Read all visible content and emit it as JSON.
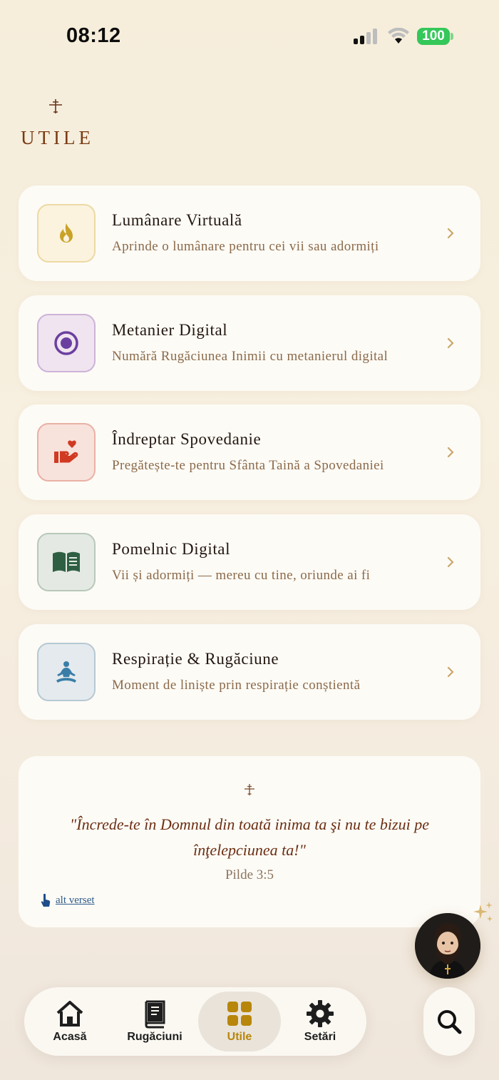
{
  "status_bar": {
    "time": "08:12",
    "battery": "100"
  },
  "header": {
    "title": "UTILE"
  },
  "cards": [
    {
      "title": "Lumânare Virtuală",
      "subtitle": "Aprinde o lumânare pentru cei vii sau adormiți",
      "icon": "flame-icon",
      "color": "#c9a227"
    },
    {
      "title": "Metanier Digital",
      "subtitle": "Numără Rugăciunea Inimii cu metanierul digital",
      "icon": "target-icon",
      "color": "#6b3fa0"
    },
    {
      "title": "Îndreptar Spovedanie",
      "subtitle": "Pregătește-te pentru Sfânta Taină a Spovedaniei",
      "icon": "hand-heart-icon",
      "color": "#d03a22"
    },
    {
      "title": "Pomelnic Digital",
      "subtitle": "Vii și adormiți — mereu cu tine, oriunde ai fi",
      "icon": "open-book-icon",
      "color": "#2f5f43"
    },
    {
      "title": "Respirație & Rugăciune",
      "subtitle": "Moment de liniște prin respirație conștientă",
      "icon": "meditation-icon",
      "color": "#3a7ea8"
    }
  ],
  "verse": {
    "text": "\"Încrede-te în Domnul din toată inima ta şi nu te bizui pe înţelepciunea ta!\"",
    "reference": "Pilde 3:5",
    "link": "alt verset"
  },
  "tabs": [
    {
      "label": "Acasă",
      "icon": "home-icon"
    },
    {
      "label": "Rugăciuni",
      "icon": "prayer-book-icon"
    },
    {
      "label": "Utile",
      "icon": "grid-icon",
      "active": true
    },
    {
      "label": "Setări",
      "icon": "gear-icon"
    }
  ],
  "colors": {
    "accent": "#b8860b",
    "title": "#7a3a13",
    "verse": "#6b2e12"
  }
}
